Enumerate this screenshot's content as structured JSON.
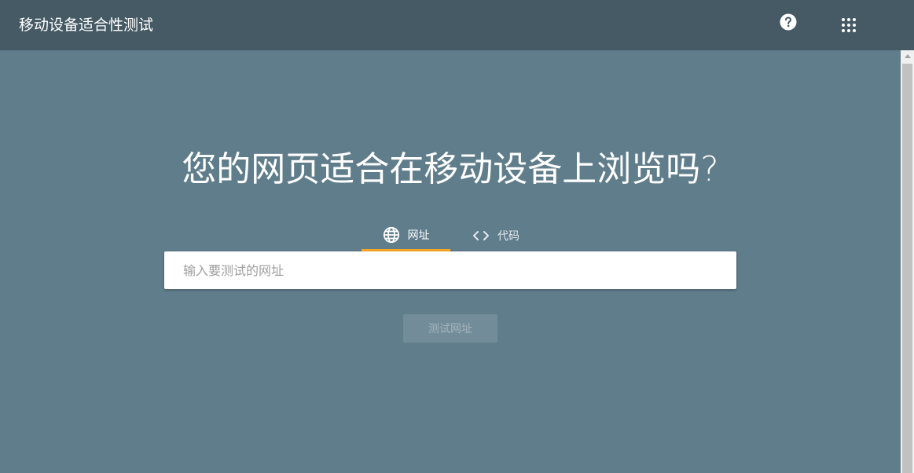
{
  "header": {
    "title": "移动设备适合性测试",
    "help_icon": "help-circle-icon",
    "apps_icon": "apps-grid-icon"
  },
  "main": {
    "headline": "您的网页适合在移动设备上浏览吗?",
    "tabs": [
      {
        "label": "网址",
        "icon": "globe-icon",
        "selected": true
      },
      {
        "label": "代码",
        "icon": "code-icon",
        "selected": false
      }
    ],
    "url_input": {
      "placeholder": "输入要测试的网址",
      "value": ""
    },
    "test_button": {
      "label": "测试网址",
      "enabled": false
    }
  },
  "colors": {
    "header_bg": "#455a64",
    "page_bg": "#607d8b",
    "tab_indicator": "#f9a825"
  }
}
